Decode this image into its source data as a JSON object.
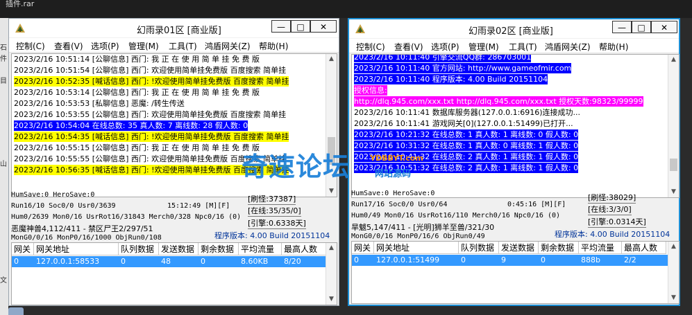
{
  "desktop": {
    "top_title": "插件.rar",
    "left_glyphs": [
      "石",
      "件",
      "目",
      "山",
      "文"
    ]
  },
  "windows": [
    {
      "title": "幻雨录01区 [商业版]",
      "controls": {
        "minimize": "—",
        "maximize": "□",
        "close": "✕"
      },
      "menu": [
        "控制(C)",
        "查看(V)",
        "选项(P)",
        "管理(M)",
        "工具(T)",
        "鸿盾网关(Z)",
        "帮助(H)"
      ],
      "log": [
        {
          "text": "2023/2/16 10:51:14 [公聊信息] 西门: 我 正 在 使 用 简 单 挂 免 费 版",
          "style": "none"
        },
        {
          "text": "2023/2/16 10:51:54 [公聊信息] 西门: 欢迎使用简单挂免费版 百度搜索 简单挂",
          "style": "none"
        },
        {
          "text": "2023/2/16 10:52:35 [喊话信息] 西门: !欢迎使用简单挂免费版 百度搜索 简单挂",
          "style": "yellow"
        },
        {
          "text": "2023/2/16 10:53:14 [公聊信息] 西门: 我 正 在 使 用 简 单 挂 免 费 版",
          "style": "none"
        },
        {
          "text": "2023/2/16 10:53:53 [私聊信息] 恶魔: /转生传送",
          "style": "none"
        },
        {
          "text": "2023/2/16 10:53:55 [公聊信息] 西门: 欢迎使用简单挂免费版 百度搜索 简单挂",
          "style": "none"
        },
        {
          "text": "2023/2/16 10:54:04 在线总数: 35 真人数: 7 离线数: 28 假人数: 0",
          "style": "blue"
        },
        {
          "text": "2023/2/16 10:54:35 [喊话信息] 西门: !欢迎使用简单挂免费版 百度搜索 简单挂",
          "style": "yellow"
        },
        {
          "text": "2023/2/16 10:55:15 [公聊信息] 西门: 我 正 在 使 用 简 单 挂 免 费 版",
          "style": "none"
        },
        {
          "text": "2023/2/16 10:55:55 [公聊信息] 西门: 欢迎使用简单挂免费版 百度搜索 简单挂",
          "style": "none"
        },
        {
          "text": "2023/2/16 10:56:35 [喊话信息] 西门: !欢迎使用简单挂免费版 百度搜索 简单挂",
          "style": "yellow"
        }
      ],
      "status": {
        "line1": "HumSave:0 HeroSave:0",
        "line2": "Run16/10 Soc0/0 Usr0/3639",
        "time": "15:12:49 [M][F]",
        "line3": "Hum0/2639 Mon0/16 UsrRot16/31843 Merch0/328 Npc0/16 (0)",
        "line4": "恶魔神兽4,112/411 - 禁区尸王2/297/51",
        "line5": "MonG0/0/16 MonP0/16/1000 ObjRun0/108",
        "refresh": "[刷怪:37387]",
        "online": "[在线:35/35/0]",
        "engine": "[引擎:0.6338天]",
        "version": "程序版本: 4.00 Build 20151104"
      },
      "table": {
        "headers": [
          "网关",
          "网关地址",
          "队列数据",
          "发送数据",
          "剩余数据",
          "平均流量",
          "最高人数"
        ],
        "rows": [
          [
            "0",
            "127.0.0.1:58533",
            "0",
            "48",
            "0",
            "8.60KB",
            "8/20"
          ]
        ]
      }
    },
    {
      "title": "幻雨录02区 [商业版]",
      "controls": {
        "minimize": "—",
        "maximize": "□",
        "close": "✕"
      },
      "menu": [
        "控制(C)",
        "查看(V)",
        "选项(P)",
        "管理(M)",
        "工具(T)",
        "鸿盾网关(Z)",
        "帮助(H)"
      ],
      "log": [
        {
          "text": "2023/2/16 10:11:40 引擎交流QQ群: 286703001",
          "style": "blue"
        },
        {
          "text": "2023/2/16 10:11:40 官方网站: http://www.gameofmir.com",
          "style": "blue"
        },
        {
          "text": "2023/2/16 10:11:40 程序版本: 4.00 Build 20151104",
          "style": "blue"
        },
        {
          "text": "授权信息:",
          "style": "magenta"
        },
        {
          "text": "http://dlq.945.com/xxx.txt http://dlq.945.com/xxx.txt 授权天数:98323/99999",
          "style": "magenta"
        },
        {
          "text": "2023/2/16 10:11:41 数据库服务器(127.0.0.1:6916)连接成功...",
          "style": "none"
        },
        {
          "text": "2023/2/16 10:11:41 游戏网关[0](127.0.0.1:51499)已打开...",
          "style": "none"
        },
        {
          "text": "2023/2/16 10:21:32 在线总数: 1 真人数: 1 离线数: 0 假人数: 0",
          "style": "blue"
        },
        {
          "text": "2023/2/16 10:31:32 在线总数: 1 真人数: 0 离线数: 1 假人数: 0",
          "style": "blue"
        },
        {
          "text": "2023/2/16 10:41:32 在线总数: 2 真人数: 1 离线数: 1 假人数: 0",
          "style": "blue"
        },
        {
          "text": "2023/2/16 10:51:32 在线总数: 2 真人数: 1 离线数: 1 假人数: 0",
          "style": "blue"
        }
      ],
      "status": {
        "line1": "HumSave:0 HeroSave:0",
        "line2": "Run17/16 Soc0/0 Usr0/64",
        "time": "0:45:16 [M][F]",
        "line3": "Hum0/49 Mon0/16 UsrRot16/110 Merch0/16 Npc0/16 (0)",
        "line4": "旱魃5,147/411 - [光明]狮羊至兽/321/30",
        "line5": "MonG0/0/16 MonP0/16/6 ObjRun0/49",
        "refresh": "[刷怪:38029]",
        "online": "[在线:3/3/0]",
        "engine": "[引擎:0.0314天]",
        "version": "程序版本: 4.00 Build 20151104"
      },
      "table": {
        "headers": [
          "网关",
          "网关地址",
          "队列数据",
          "发送数据",
          "剩余数据",
          "平均流量",
          "最高人数"
        ],
        "rows": [
          [
            "0",
            "127.0.0.1:51499",
            "0",
            "9",
            "0",
            "888b",
            "2/2"
          ]
        ]
      }
    }
  ],
  "watermark": {
    "main": "奇速论坛",
    "sub": "YDBBYT.com",
    "sub2": "网站源码"
  },
  "colors": {
    "highlight_yellow": "#ffff00",
    "highlight_blue": "#0000ff",
    "highlight_magenta": "#ff00ff",
    "table_selection": "#3399ff",
    "active_border": "#1b8fd6",
    "version_text": "#003399"
  }
}
